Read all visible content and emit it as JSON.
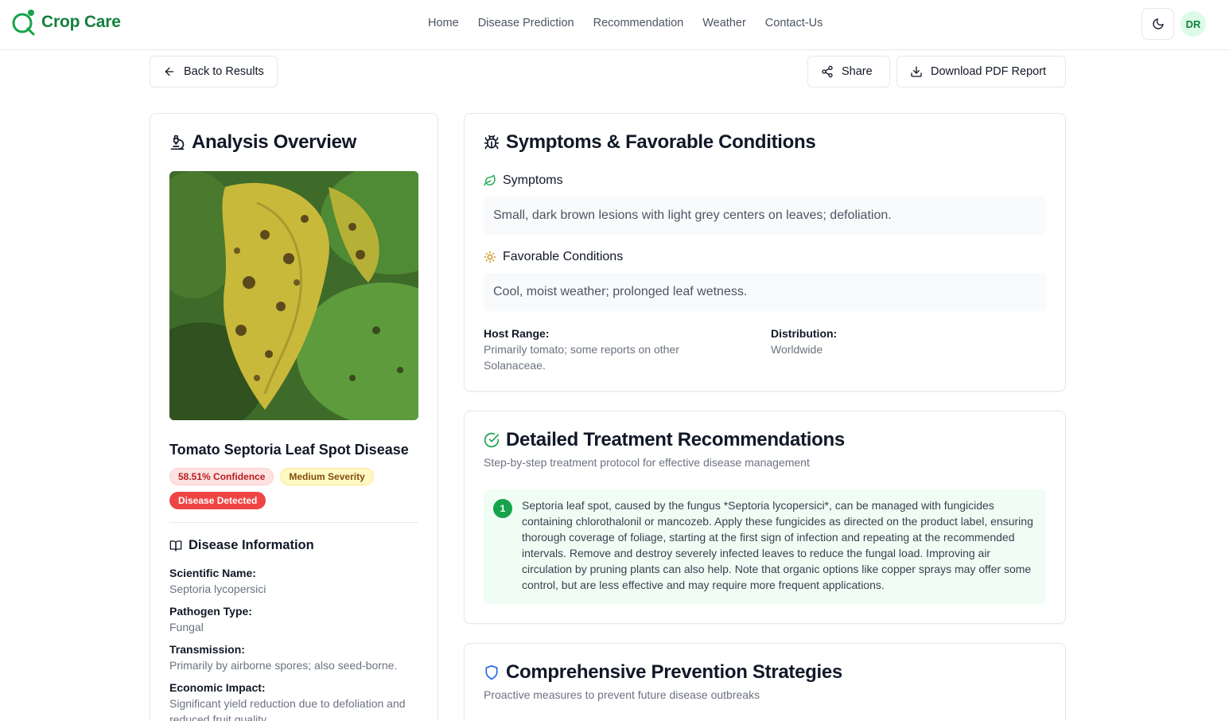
{
  "header": {
    "brand": "Crop Care",
    "nav": [
      "Home",
      "Disease Prediction",
      "Recommendation",
      "Weather",
      "Contact-Us"
    ],
    "avatar_initials": "DR",
    "brand_color": "#15803d"
  },
  "actions": {
    "back": "Back to Results",
    "share": "Share",
    "download": "Download PDF Report"
  },
  "overview": {
    "title": "Analysis Overview",
    "disease_name": "Tomato Septoria Leaf Spot Disease",
    "confidence_badge": "58.51% Confidence",
    "severity_badge": "Medium Severity",
    "detected_badge": "Disease Detected",
    "info_title": "Disease Information",
    "info": [
      {
        "label": "Scientific Name:",
        "value": "Septoria lycopersici"
      },
      {
        "label": "Pathogen Type:",
        "value": "Fungal"
      },
      {
        "label": "Transmission:",
        "value": "Primarily by airborne spores; also seed-borne."
      },
      {
        "label": "Economic Impact:",
        "value": "Significant yield reduction due to defoliation and reduced fruit quality."
      }
    ]
  },
  "symptoms_card": {
    "title": "Symptoms & Favorable Conditions",
    "symptoms_label": "Symptoms",
    "symptoms_text": "Small, dark brown lesions with light grey centers on leaves; defoliation.",
    "conditions_label": "Favorable Conditions",
    "conditions_text": "Cool, moist weather; prolonged leaf wetness.",
    "host_label": "Host Range:",
    "host_value": "Primarily tomato; some reports on other Solanaceae.",
    "distribution_label": "Distribution:",
    "distribution_value": "Worldwide"
  },
  "treatment_card": {
    "title": "Detailed Treatment Recommendations",
    "subtitle": "Step-by-step treatment protocol for effective disease management",
    "steps": [
      {
        "number": "1",
        "text": "Septoria leaf spot, caused by the fungus *Septoria lycopersici*, can be managed with fungicides containing chlorothalonil or mancozeb. Apply these fungicides as directed on the product label, ensuring thorough coverage of foliage, starting at the first sign of infection and repeating at the recommended intervals. Remove and destroy severely infected leaves to reduce the fungal load. Improving air circulation by pruning plants can also help. Note that organic options like copper sprays may offer some control, but are less effective and may require more frequent applications."
      }
    ]
  },
  "prevention_card": {
    "title": "Comprehensive Prevention Strategies",
    "subtitle": "Proactive measures to prevent future disease outbreaks"
  }
}
